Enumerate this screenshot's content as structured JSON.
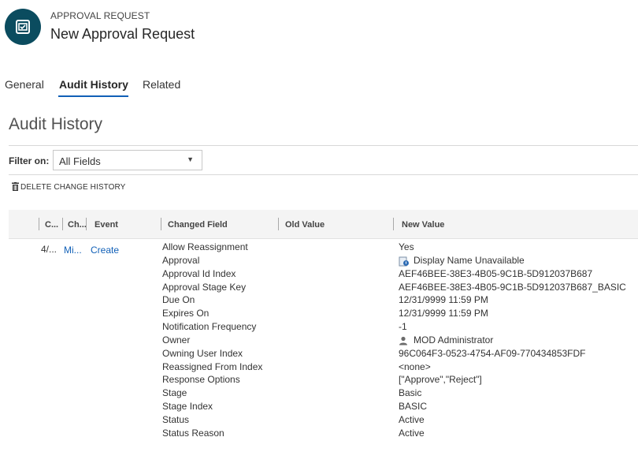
{
  "header": {
    "entity_type": "APPROVAL REQUEST",
    "record_title": "New Approval Request",
    "icon": "approval-record-icon"
  },
  "tabs": [
    {
      "label": "General",
      "active": false
    },
    {
      "label": "Audit History",
      "active": true
    },
    {
      "label": "Related",
      "active": false
    }
  ],
  "section": {
    "title": "Audit History",
    "filter_label": "Filter on:",
    "filter_value": "All Fields",
    "delete_label": "DELETE CHANGE HISTORY"
  },
  "grid": {
    "columns": [
      "C...",
      "Ch...",
      "Event",
      "Changed Field",
      "Old Value",
      "New Value"
    ],
    "row": {
      "changed_date": "4/...",
      "changed_by": "Mi...",
      "event": "Create",
      "fields": [
        "Allow Reassignment",
        "Approval",
        "Approval Id Index",
        "Approval Stage Key",
        "Due On",
        "Expires On",
        "Notification Frequency",
        "Owner",
        "Owning User Index",
        "Reassigned From Index",
        "Response Options",
        "Stage",
        "Stage Index",
        "Status",
        "Status Reason"
      ],
      "new_values": [
        "Yes",
        "Display Name Unavailable",
        "AEF46BEE-38E3-4B05-9C1B-5D912037B687",
        "AEF46BEE-38E3-4B05-9C1B-5D912037B687_BASIC",
        "12/31/9999 11:59 PM",
        "12/31/9999 11:59 PM",
        "-1",
        "MOD Administrator",
        "96C064F3-0523-4754-AF09-770434853FDF",
        "<none>",
        "[\"Approve\",\"Reject\"]",
        "Basic",
        "BASIC",
        "Active",
        "Active"
      ]
    }
  },
  "colors": {
    "accent": "#1160b7",
    "entity_icon_bg": "#0b4c5f"
  }
}
